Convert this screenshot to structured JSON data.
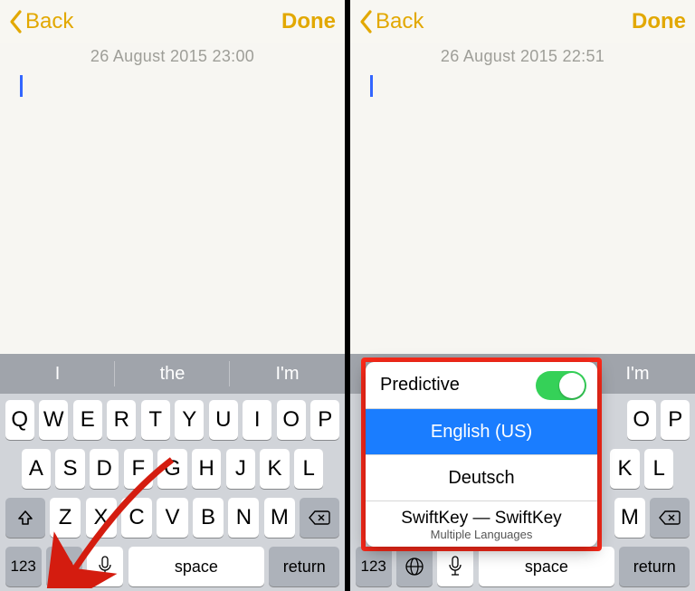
{
  "left": {
    "nav": {
      "back": "Back",
      "done": "Done"
    },
    "timestamp": "26 August 2015 23:00",
    "predictions": [
      "I",
      "the",
      "I'm"
    ],
    "rows": {
      "r1": [
        "Q",
        "W",
        "E",
        "R",
        "T",
        "Y",
        "U",
        "I",
        "O",
        "P"
      ],
      "r2": [
        "A",
        "S",
        "D",
        "F",
        "G",
        "H",
        "J",
        "K",
        "L"
      ],
      "r3": [
        "Z",
        "X",
        "C",
        "V",
        "B",
        "N",
        "M"
      ]
    },
    "bottom": {
      "numbers": "123",
      "space": "space",
      "return": "return"
    }
  },
  "right": {
    "nav": {
      "back": "Back",
      "done": "Done"
    },
    "timestamp": "26 August 2015 22:51",
    "predictions": [
      "",
      "",
      "I'm"
    ],
    "rows": {
      "r1_visible": [
        "O",
        "P"
      ],
      "r2_visible": [
        "K",
        "L"
      ],
      "r3_visible": [
        "M"
      ]
    },
    "bottom": {
      "numbers": "123",
      "space": "space",
      "return": "return"
    },
    "popup": {
      "predictive_label": "Predictive",
      "predictive_on": true,
      "selected": "English (US)",
      "option2": "Deutsch",
      "option3_main": "SwiftKey — SwiftKey",
      "option3_sub": "Multiple Languages"
    }
  }
}
